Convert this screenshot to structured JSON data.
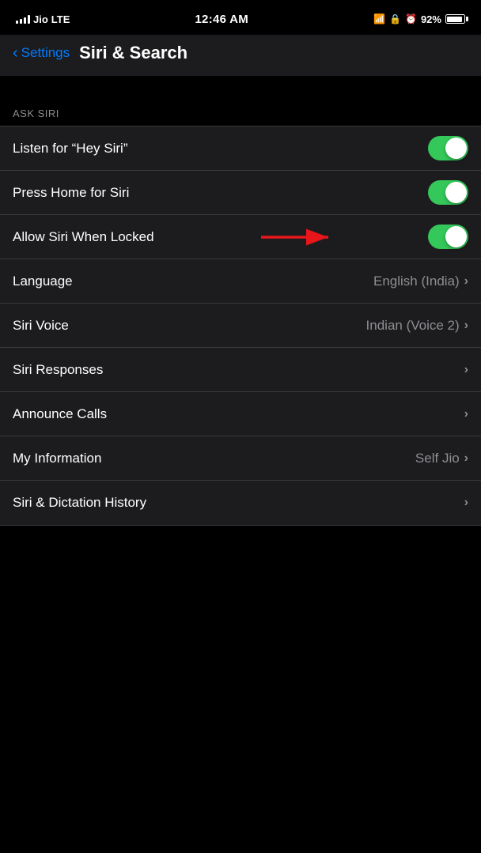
{
  "statusBar": {
    "carrier": "Jio",
    "network": "LTE",
    "time": "12:46 AM",
    "battery": "92%"
  },
  "header": {
    "backLabel": "Settings",
    "title": "Siri & Search"
  },
  "askSiriSection": {
    "label": "ASK SIRI",
    "rows": [
      {
        "id": "hey-siri",
        "label": "Listen for “Hey Siri”",
        "type": "toggle",
        "value": true
      },
      {
        "id": "press-home",
        "label": "Press Home for Siri",
        "type": "toggle",
        "value": true
      },
      {
        "id": "allow-locked",
        "label": "Allow Siri When Locked",
        "type": "toggle",
        "value": true
      },
      {
        "id": "language",
        "label": "Language",
        "type": "value-chevron",
        "value": "English (India)"
      },
      {
        "id": "siri-voice",
        "label": "Siri Voice",
        "type": "value-chevron",
        "value": "Indian (Voice 2)"
      },
      {
        "id": "siri-responses",
        "label": "Siri Responses",
        "type": "chevron",
        "value": ""
      },
      {
        "id": "announce-calls",
        "label": "Announce Calls",
        "type": "chevron",
        "value": ""
      },
      {
        "id": "my-information",
        "label": "My Information",
        "type": "value-chevron",
        "value": "Self Jio"
      },
      {
        "id": "siri-dictation",
        "label": "Siri & Dictation History",
        "type": "chevron",
        "value": ""
      }
    ]
  }
}
